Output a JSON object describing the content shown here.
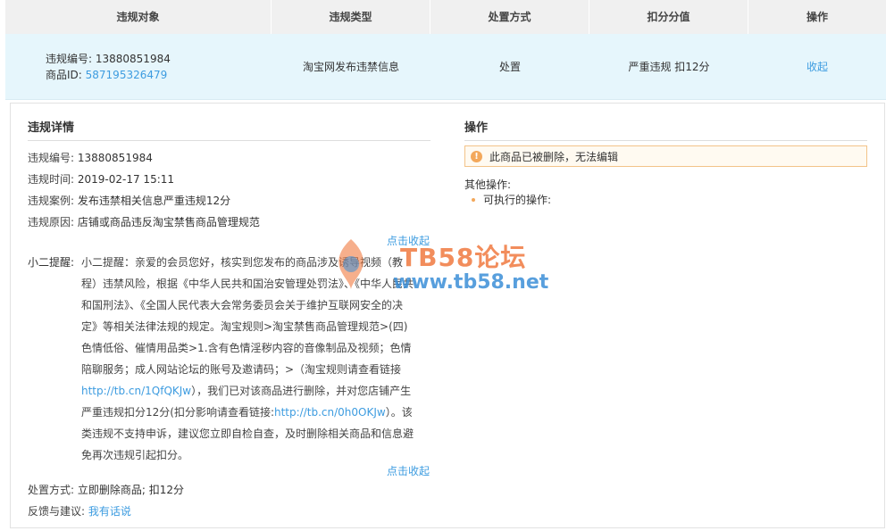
{
  "table": {
    "headers": [
      "违规对象",
      "违规类型",
      "处置方式",
      "扣分分值",
      "操作"
    ],
    "row": {
      "violation_no_label": "违规编号: ",
      "violation_no": "13880851984",
      "item_id_label": "商品ID: ",
      "item_id": "587195326479",
      "type": "淘宝网发布违禁信息",
      "disposal": "处置",
      "points": "严重违规 扣12分",
      "action": "收起"
    }
  },
  "detail": {
    "title": "违规详情",
    "no_label": "违规编号:",
    "no_value": "13880851984",
    "time_label": "违规时间:",
    "time_value": "2019-02-17 15:11",
    "case_label": "违规案例:",
    "case_value": "发布违禁相关信息严重违规12分",
    "reason_label": "违规原因:",
    "reason_value": "店铺或商品违反淘宝禁售商品管理规范",
    "collapse_top": "点击收起",
    "reminder_label": "小二提醒:",
    "reminder_text_1": "小二提醒：亲爱的会员您好，核实到您发布的商品涉及诱导视频（教程）违禁风险，根据《中华人民共和国治安管理处罚法》、《中华人民共和国刑法》、《全国人民代表大会常务委员会关于维护互联网安全的决定》等相关法律法规的规定。淘宝规则>淘宝禁售商品管理规范>(四)色情低俗、催情用品类>1.含有色情淫秽内容的音像制品及视频；色情陪聊服务；成人网站论坛的账号及邀请码；>（淘宝规则请查看链接",
    "link_1": "http://tb.cn/1QfQKJw",
    "reminder_text_2": "），我们已对该商品进行删除，并对您店铺产生严重违规扣分12分(扣分影响请查看链接:",
    "link_2": "http://tb.cn/0h0OKJw",
    "reminder_text_3": "）。该类违规不支持申诉，建议您立即自检自查，及时删除相关商品和信息避免再次违规引起扣分。",
    "collapse_bottom": "点击收起",
    "disposal_label": "处置方式:",
    "disposal_value": "立即删除商品; 扣12分",
    "feedback_label": "反馈与建议:",
    "feedback_link": "我有话说"
  },
  "operation": {
    "title": "操作",
    "warning_icon": "!",
    "warning": "此商品已被删除，无法编辑",
    "other_label": "其他操作:",
    "other_item": "可执行的操作:"
  },
  "watermark": {
    "title": "TB58论坛",
    "url": "www.tb58.net"
  },
  "colors": {
    "link": "#3d9ce0",
    "row_highlight": "#e6f6fc",
    "warning_border": "#f3c389",
    "warning_icon": "#f3a85b"
  }
}
